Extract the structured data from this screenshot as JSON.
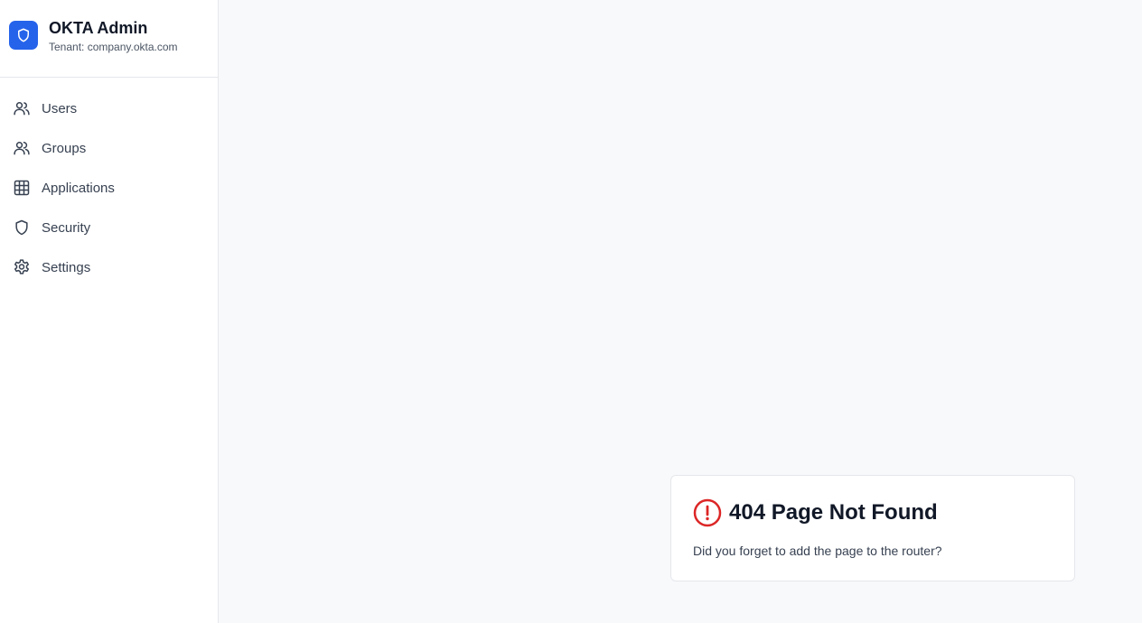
{
  "brand": {
    "title": "OKTA Admin",
    "tenant": "Tenant: company.okta.com",
    "accent_color": "#2563eb",
    "logo_icon": "shield-icon"
  },
  "sidebar": {
    "items": [
      {
        "label": "Users",
        "icon": "users-icon"
      },
      {
        "label": "Groups",
        "icon": "groups-icon"
      },
      {
        "label": "Applications",
        "icon": "grid-icon"
      },
      {
        "label": "Security",
        "icon": "shield-icon"
      },
      {
        "label": "Settings",
        "icon": "gear-icon"
      }
    ]
  },
  "error": {
    "title": "404 Page Not Found",
    "message": "Did you forget to add the page to the router?",
    "icon": "alert-circle-icon",
    "icon_color": "#dc2626"
  }
}
